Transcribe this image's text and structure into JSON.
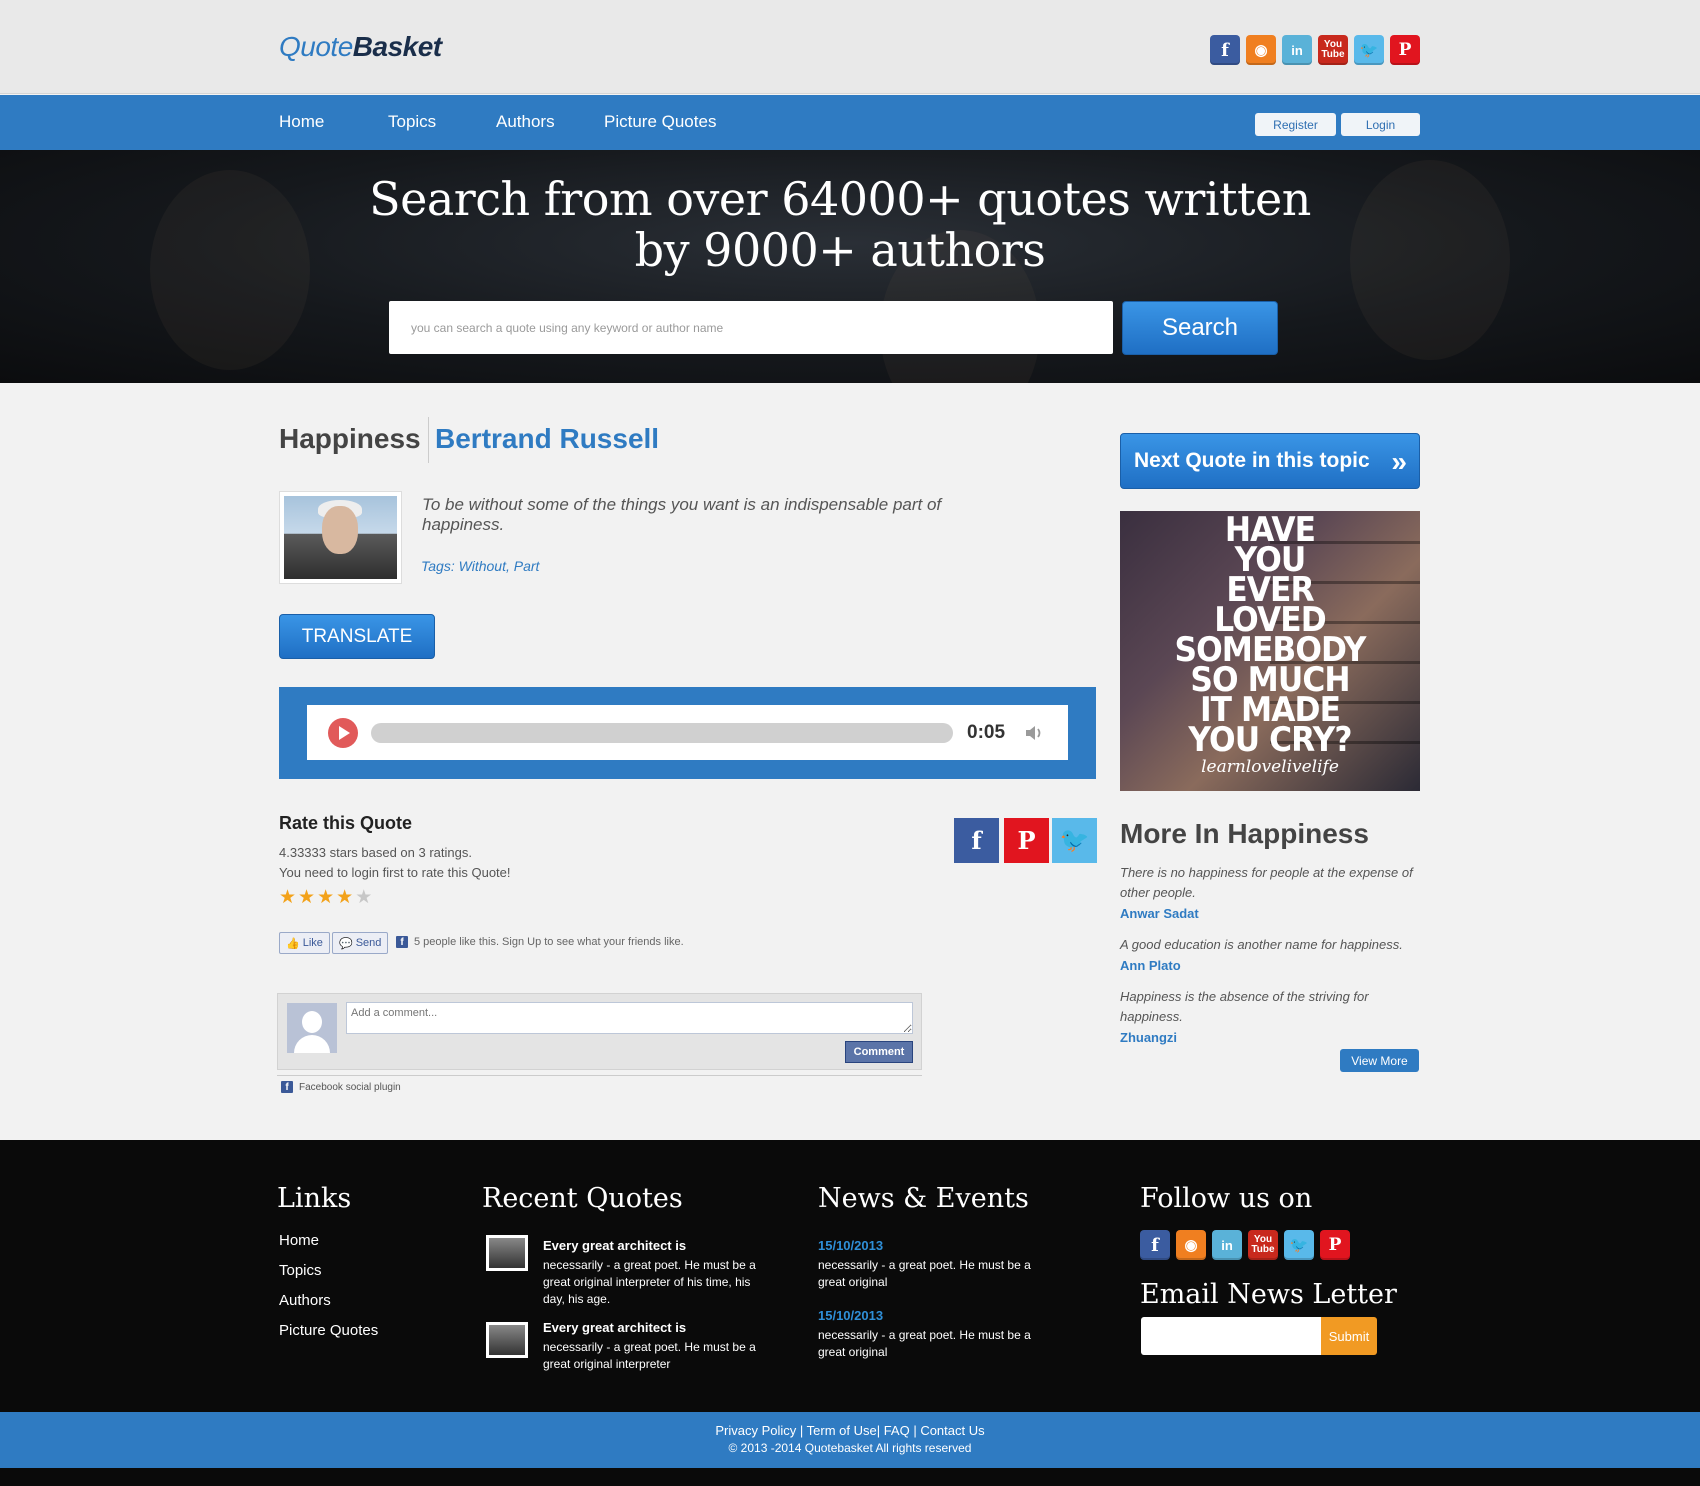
{
  "header": {
    "logo_part1": "Quote",
    "logo_part2": "Basket",
    "social": [
      {
        "name": "facebook-icon",
        "glyph": "f"
      },
      {
        "name": "rss-icon",
        "glyph": "◉"
      },
      {
        "name": "linkedin-icon",
        "glyph": "in"
      },
      {
        "name": "youtube-icon",
        "glyph": "You Tube"
      },
      {
        "name": "twitter-icon",
        "glyph": "🐦"
      },
      {
        "name": "pinterest-icon",
        "glyph": "P"
      }
    ]
  },
  "nav": {
    "items": [
      "Home",
      "Topics",
      "Authors",
      "Picture Quotes"
    ],
    "register": "Register",
    "login": "Login"
  },
  "hero": {
    "title_line1": "Search from over 64000+ quotes written",
    "title_line2": "by 9000+ authors",
    "search_placeholder": "you can search a quote using any keyword or author name",
    "search_button": "Search"
  },
  "quote": {
    "topic": "Happiness",
    "author": "Bertrand Russell",
    "text": "To be without some of the things you want is an indispensable part of happiness.",
    "tags_label": "Tags:",
    "tags": "Without, Part",
    "translate": "TRANSLATE",
    "audio_time": "0:05",
    "audio_progress": 0.0
  },
  "rating": {
    "title": "Rate this Quote",
    "summary": "4.33333 stars based on 3 ratings.",
    "login_note": "You need to login first to rate this Quote!",
    "stars_filled": 4,
    "stars_total": 5,
    "star_glyph": "★"
  },
  "facebook": {
    "like": "Like",
    "send": "Send",
    "like_text": "5 people like this. Sign Up to see what your friends like.",
    "comment_placeholder": "Add a comment...",
    "comment_button": "Comment",
    "plugin": "Facebook social plugin"
  },
  "sidebar": {
    "next_button": "Next Quote in this topic",
    "next_icon": "»",
    "picture_quote_text": "HAVE YOU EVER LOVED SOMEBODY SO MUCH IT MADE YOU CRY?",
    "picture_quote_lines": [
      "HAVE",
      "YOU",
      "EVER",
      "LOVED",
      "SOMEBODY",
      "SO MUCH",
      "IT MADE",
      "YOU CRY?"
    ],
    "picture_quote_signature": "learnlovelivelife",
    "more_title": "More In Happiness",
    "more": [
      {
        "quote": "There is no happiness for people at the expense of other people.",
        "author": "Anwar Sadat"
      },
      {
        "quote": "A good education is another name for happiness.",
        "author": "Ann Plato"
      },
      {
        "quote": "Happiness is the absence of the striving for happiness.",
        "author": "Zhuangzi"
      }
    ],
    "view_more": "View More"
  },
  "footer": {
    "links_title": "Links",
    "links": [
      "Home",
      "Topics",
      "Authors",
      "Picture Quotes"
    ],
    "recent_title": "Recent Quotes",
    "recent": [
      {
        "head": "Every great architect is",
        "body": "necessarily - a great poet. He must be a great original interpreter of his time, his day, his age."
      },
      {
        "head": "Every great architect is",
        "body": "necessarily - a great poet. He must be a great original interpreter"
      }
    ],
    "news_title": "News & Events",
    "news": [
      {
        "date": "15/10/2013",
        "body": "necessarily - a great poet. He must be a great original"
      },
      {
        "date": "15/10/2013",
        "body": "necessarily - a great poet. He must be a great original"
      }
    ],
    "follow_title": "Follow us on",
    "newsletter_title": "Email News Letter",
    "submit": "Submit",
    "bottom_links": "Privacy Policy | Term of Use| FAQ | Contact Us",
    "copyright": "© 2013 -2014 Quotebasket All rights reserved"
  }
}
